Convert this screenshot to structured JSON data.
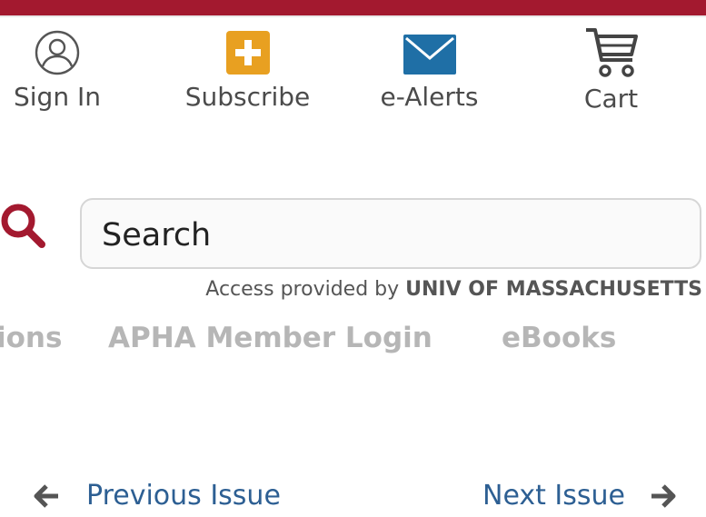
{
  "utility_nav": {
    "sign_in": "Sign In",
    "subscribe": "Subscribe",
    "e_alerts": "e-Alerts",
    "cart": "Cart"
  },
  "search": {
    "placeholder": "Search",
    "access_prefix": "Access provided by",
    "institution": "UNIV OF MASSACHUSETTS"
  },
  "secondary_nav": {
    "partial_item": "ions",
    "apha_login": "APHA Member Login",
    "ebooks": "eBooks"
  },
  "issue_nav": {
    "previous": "Previous Issue",
    "next": "Next Issue"
  },
  "colors": {
    "brand_red": "#a3192f",
    "subscribe_orange": "#e8a021",
    "mail_blue": "#1f6fa6",
    "link_blue": "#2d5f93",
    "muted_gray": "#b6b6b6"
  },
  "icons": [
    "user-circle-icon",
    "plus-square-icon",
    "envelope-icon",
    "cart-icon",
    "search-icon",
    "arrow-left-icon",
    "arrow-right-icon"
  ]
}
